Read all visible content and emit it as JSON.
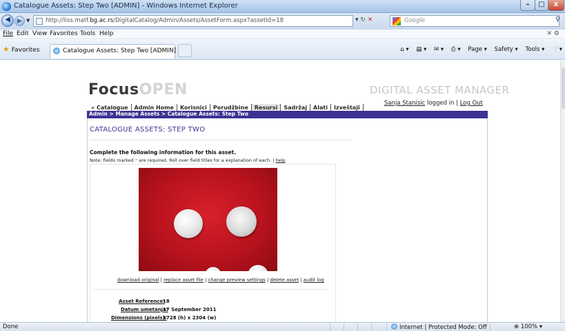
{
  "window": {
    "title": "Catalogue Assets: Step Two [ADMIN] - Windows Internet Explorer",
    "min_icon": "–",
    "max_icon": "□",
    "close_icon": "x"
  },
  "address": {
    "url_prefix": "http://liss.matf.",
    "url_domain": "bg.ac.rs",
    "url_suffix": "/DigitalCatalog/Admin/Assets/AssetForm.aspx?assetId=18",
    "search_placeholder": "Google"
  },
  "menu": {
    "items": [
      "File",
      "Edit",
      "View",
      "Favorites",
      "Tools",
      "Help"
    ]
  },
  "tabs": {
    "favorites_label": "Favorites",
    "active_tab_title": "Catalogue Assets: Step Two [ADMIN]",
    "commands": [
      "Page ▾",
      "Safety ▾",
      "Tools ▾"
    ]
  },
  "site": {
    "logo_part1": "Focus",
    "logo_part2": "OPEN",
    "tagline": "DIGITAL ASSET MANAGER",
    "nav": [
      "« Catalogue",
      "Admin Home",
      "Korisnici",
      "Porudžbine",
      "Resursi",
      "Sadržaj",
      "Alati",
      "Izveštaji"
    ],
    "active_nav": "Resursi",
    "user_name": "Sanja Stanisic",
    "logged_in_text": " logged in | ",
    "logout": "Log Out",
    "breadcrumb": "Admin > Manage Assets > Catalogue Assets: Step Two"
  },
  "form": {
    "page_title": "CATALOGUE ASSETS: STEP TWO",
    "intro": "Complete the following information for this asset.",
    "note_before": "Note: fields marked ",
    "note_mark": "*",
    "note_after": " are required.  Roll over field titles for a explanation of each. | ",
    "help_link": "help",
    "actions": [
      "download original",
      "replace asset file",
      "change preview settings",
      "delete asset",
      "audit log"
    ],
    "fields": [
      {
        "label": "Asset Reference:",
        "value": "18"
      },
      {
        "label": "Datum umetanja:",
        "value": "17 September 2011"
      },
      {
        "label": "Dimensions (pixels):",
        "value": "1728 (h) x 2304 (w)"
      }
    ]
  },
  "status": {
    "left": "Done",
    "zone": "Internet | Protected Mode: Off",
    "zoom": "100%"
  }
}
